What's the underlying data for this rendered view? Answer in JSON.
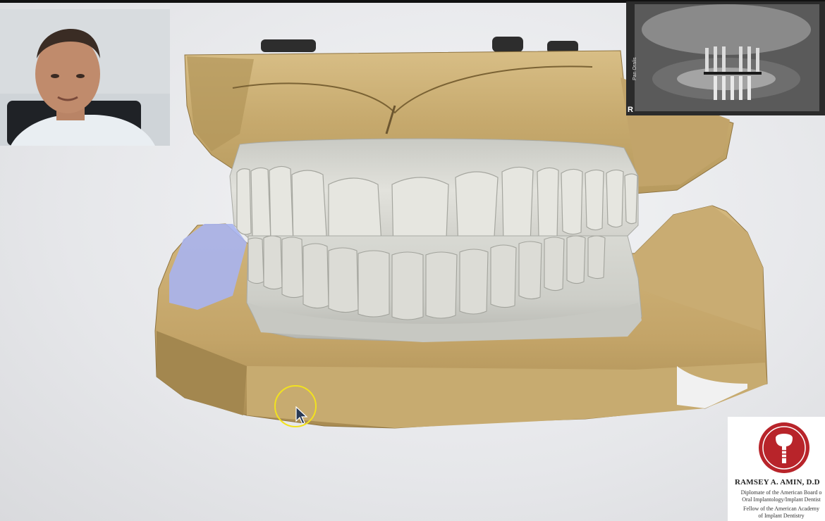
{
  "window": {
    "title": ""
  },
  "presenter": {
    "name": ""
  },
  "xray": {
    "marker": "R",
    "side_label": "Pan Oralis"
  },
  "logo": {
    "name": "RAMSEY A. AMIN, D.D",
    "line1": "Diplomate of the American Board o",
    "line2": "Oral Implantology/Implant Dentist",
    "line3": "Fellow of the American Academy",
    "line4": "of Implant Dentistry"
  },
  "colors": {
    "model_stone": "#c9ad72",
    "model_stone_dark": "#8f7440",
    "teeth": "#dcdcd6",
    "scan_highlight": "#a9b4f0",
    "cursor_ring": "#f2e21f",
    "logo_red": "#b8242a"
  },
  "icons": [
    "mouse-pointer-icon",
    "implant-logo-icon"
  ]
}
